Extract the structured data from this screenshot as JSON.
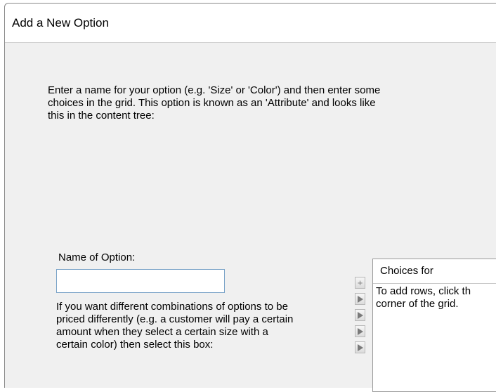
{
  "window": {
    "title": "Add a New Option"
  },
  "intro_text": "Enter a name for your option (e.g. 'Size' or 'Color') and then enter some\nchoices in the grid. This option is known as an 'Attribute' and looks like\nthis in the content tree:",
  "name_field": {
    "label": "Name of Option:",
    "value": "",
    "placeholder": ""
  },
  "combination_text": "If you want different combinations of options to be\npriced differently (e.g. a customer will pay a certain\namount when they select a certain size with a\ncertain color) then select this box:",
  "grid": {
    "header": "Choices for",
    "hint": "To add rows, click th\ncorner of the grid.",
    "buttons": [
      {
        "icon": "plus-icon",
        "glyph": "+"
      },
      {
        "icon": "row-arrow-icon"
      },
      {
        "icon": "row-arrow-icon"
      },
      {
        "icon": "row-arrow-icon"
      },
      {
        "icon": "row-arrow-icon"
      }
    ]
  }
}
